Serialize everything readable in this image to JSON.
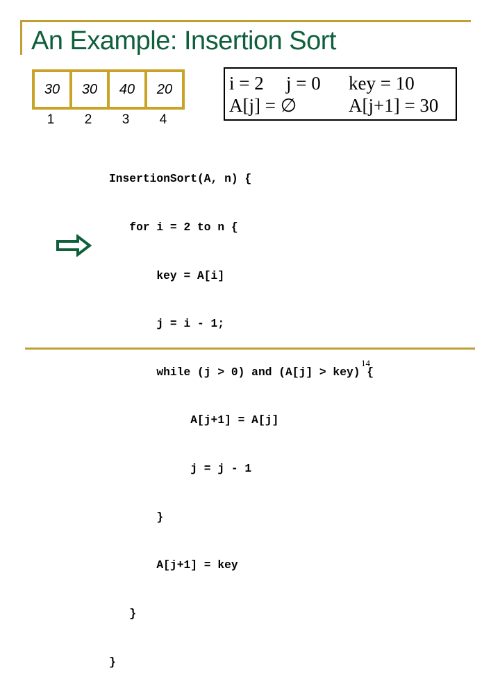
{
  "slide": {
    "title": "An Example: Insertion Sort",
    "page_number": "14"
  },
  "array": {
    "values": [
      "30",
      "30",
      "40",
      "20"
    ],
    "indices": [
      "1",
      "2",
      "3",
      "4"
    ]
  },
  "state": {
    "i": "i = 2",
    "j": "j = 0",
    "key": "key = 10",
    "a_j": "A[j] = ∅",
    "a_j_plus_1": "A[j+1] = 30"
  },
  "code": {
    "lines": [
      "InsertionSort(A, n) {",
      "   for i = 2 to n {",
      "       key = A[i]",
      "       j = i - 1;",
      "       while (j > 0) and (A[j] > key) {",
      "            A[j+1] = A[j]",
      "            j = j - 1",
      "       }",
      "       A[j+1] = key",
      "   }",
      "}"
    ]
  },
  "indicator": {
    "icon": "right-arrow-icon",
    "points_to_line": 7
  },
  "colors": {
    "title": "#0f5f3a",
    "frame": "#bfa037",
    "array_border": "#c9a227",
    "arrow": "#0f5f3a"
  }
}
